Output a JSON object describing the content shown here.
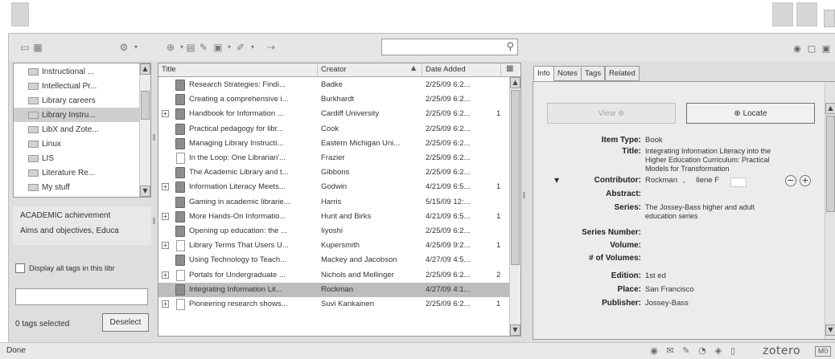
{
  "toolbar": {
    "new_collection_icon": "new-collection-icon",
    "new_group_icon": "new-group-icon",
    "actions_icon": "gear-icon",
    "new_item_icon": "new-item-icon",
    "new_note_icon": "new-note-icon",
    "attach_icon": "paperclip-icon",
    "search_placeholder": "",
    "search_value": ""
  },
  "collections": {
    "items": [
      {
        "label": "Instructional ..."
      },
      {
        "label": "Intellectual Pr..."
      },
      {
        "label": "Library careers"
      },
      {
        "label": "Library Instru...",
        "selected": true
      },
      {
        "label": "LibX and Zote..."
      },
      {
        "label": "Linux"
      },
      {
        "label": "LIS"
      },
      {
        "label": "Literature Re..."
      },
      {
        "label": "My stuff"
      }
    ]
  },
  "tags": {
    "items": [
      "ACADEMIC achievement",
      "Aims and objectives, Educa"
    ],
    "display_all_label": "Display all tags in this libr",
    "filter_value": "",
    "selected_count": "0 tags selected",
    "deselect_label": "Deselect"
  },
  "items_list": {
    "columns": {
      "title": "Title",
      "creator": "Creator",
      "date_added": "Date Added"
    },
    "rows": [
      {
        "title": "Research Strategies: Findi...",
        "creator": "Badke",
        "date": "2/25/09 6:2...",
        "count": "",
        "twisty": "",
        "icon": "book"
      },
      {
        "title": "Creating a comprehensive i...",
        "creator": "Burkhardt",
        "date": "2/25/09 6:2...",
        "count": "",
        "twisty": "",
        "icon": "book"
      },
      {
        "title": "Handbook for Information ...",
        "creator": "Cardiff University",
        "date": "2/25/09 6:2...",
        "count": "1",
        "twisty": "+",
        "icon": "book"
      },
      {
        "title": "Practical pedagogy for libr...",
        "creator": "Cook",
        "date": "2/25/09 6:2...",
        "count": "",
        "twisty": "",
        "icon": "book"
      },
      {
        "title": "Managing Library Instructi...",
        "creator": "Eastern Michigan Uni...",
        "date": "2/25/09 6:2...",
        "count": "",
        "twisty": "",
        "icon": "book"
      },
      {
        "title": "In the Loop: One Librarian'...",
        "creator": "Frazier",
        "date": "2/25/09 6:2...",
        "count": "",
        "twisty": "",
        "icon": "doc"
      },
      {
        "title": "The Academic Library and t...",
        "creator": "Gibbons",
        "date": "2/25/09 6:2...",
        "count": "",
        "twisty": "",
        "icon": "book"
      },
      {
        "title": "Information Literacy Meets...",
        "creator": "Godwin",
        "date": "4/21/09 6:5...",
        "count": "1",
        "twisty": "+",
        "icon": "book"
      },
      {
        "title": "Gaming in academic librarie...",
        "creator": "Harris",
        "date": "5/15/09 12:...",
        "count": "",
        "twisty": "",
        "icon": "book"
      },
      {
        "title": "More Hands-On Informatio...",
        "creator": "Hunt and Birks",
        "date": "4/21/09 6:5...",
        "count": "1",
        "twisty": "+",
        "icon": "book"
      },
      {
        "title": "Opening up education: the ...",
        "creator": "Iiyoshi",
        "date": "2/25/09 6:2...",
        "count": "",
        "twisty": "",
        "icon": "book"
      },
      {
        "title": "Library Terms That Users U...",
        "creator": "Kupersmith",
        "date": "4/25/09 9:2...",
        "count": "1",
        "twisty": "+",
        "icon": "doc"
      },
      {
        "title": "Using Technology to Teach...",
        "creator": "Mackey and Jacobson",
        "date": "4/27/09 4:5...",
        "count": "",
        "twisty": "",
        "icon": "book"
      },
      {
        "title": "Portals for Undergraduate ...",
        "creator": "Nichols and Mellinger",
        "date": "2/25/09 6:2...",
        "count": "2",
        "twisty": "+",
        "icon": "doc"
      },
      {
        "title": "Integrating Information Lit...",
        "creator": "Rockman",
        "date": "4/27/09 4:1...",
        "count": "",
        "twisty": "",
        "icon": "book",
        "selected": true
      },
      {
        "title": "Pioneering research shows...",
        "creator": "Suvi Kankainen",
        "date": "2/25/09 6:2...",
        "count": "1",
        "twisty": "+",
        "icon": "doc"
      }
    ]
  },
  "info_pane": {
    "tabs": [
      "Info",
      "Notes",
      "Tags",
      "Related"
    ],
    "view_label": "View ⊕",
    "locate_label": "⊕ Locate",
    "fields": {
      "item_type_label": "Item Type:",
      "item_type": "Book",
      "title_label": "Title:",
      "title": "Integrating Information Literacy into the Higher Education Curriculum: Practical Models for Transformation",
      "contributor_label": "Contributor:",
      "contributor_last": "Rockman",
      "contributor_sep": ",",
      "contributor_first": "Ilene F",
      "abstract_label": "Abstract:",
      "series_label": "Series:",
      "series": "The Jossey-Bass higher and adult education series",
      "series_number_label": "Series Number:",
      "volume_label": "Volume:",
      "num_volumes_label": "# of Volumes:",
      "edition_label": "Edition:",
      "edition": "1st ed",
      "place_label": "Place:",
      "place": "San Francisco",
      "publisher_label": "Publisher:",
      "publisher": "Jossey-Bass"
    }
  },
  "statusbar": {
    "text": "Done",
    "brand": "zotero",
    "badge": "M0"
  }
}
